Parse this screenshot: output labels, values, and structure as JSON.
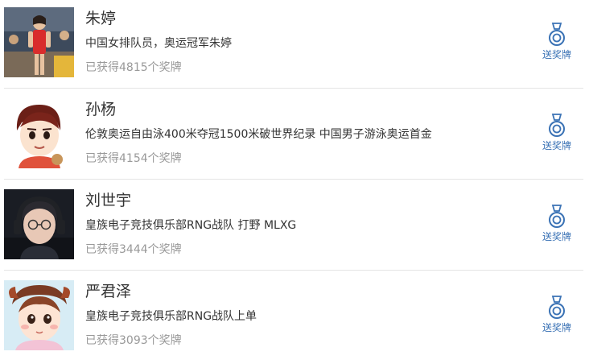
{
  "accent_color": "#3a72b5",
  "medal_icon": "medal-icon",
  "people": [
    {
      "name": "朱婷",
      "description": "中国女排队员，奥运冠军朱婷",
      "medal_count": "已获得4815个奖牌",
      "action_label": "送奖牌"
    },
    {
      "name": "孙杨",
      "description": "伦敦奥运自由泳400米夺冠1500米破世界纪录 中国男子游泳奥运首金",
      "medal_count": "已获得4154个奖牌",
      "action_label": "送奖牌"
    },
    {
      "name": "刘世宇",
      "description": "皇族电子竞技俱乐部RNG战队 打野 MLXG",
      "medal_count": "已获得3444个奖牌",
      "action_label": "送奖牌"
    },
    {
      "name": "严君泽",
      "description": "皇族电子竞技俱乐部RNG战队上单",
      "medal_count": "已获得3093个奖牌",
      "action_label": "送奖牌"
    }
  ]
}
